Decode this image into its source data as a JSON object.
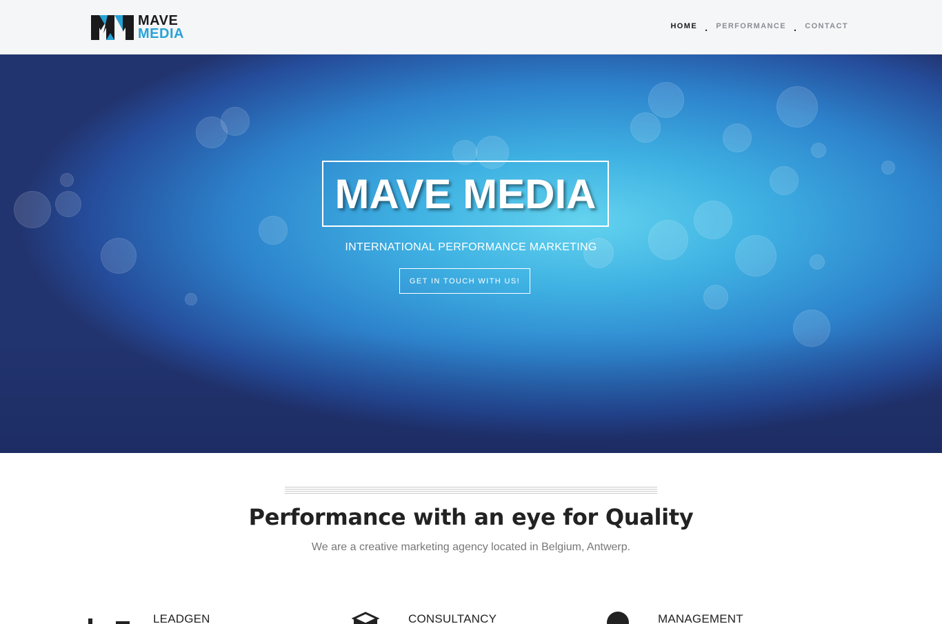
{
  "logo": {
    "line1": "MAVE",
    "line2": "MEDIA",
    "colors": {
      "dark": "#1a1a1a",
      "accent": "#27a3d6"
    }
  },
  "nav": {
    "items": [
      {
        "label": "HOME",
        "active": true
      },
      {
        "label": "PERFORMANCE",
        "active": false
      },
      {
        "label": "CONTACT",
        "active": false
      }
    ],
    "separator": "."
  },
  "hero": {
    "title": "MAVE MEDIA",
    "subtitle": "INTERNATIONAL PERFORMANCE MARKETING",
    "cta_label": "GET IN TOUCH WITH US!"
  },
  "section": {
    "title": "Performance with an eye for Quality",
    "subtitle": "We are a creative marketing agency located in Belgium, Antwerp."
  },
  "services": [
    {
      "title": "LEADGEN",
      "icon": "chart-bars-icon"
    },
    {
      "title": "CONSULTANCY",
      "icon": "cube-icon"
    },
    {
      "title": "MANAGEMENT",
      "icon": "circle-icon"
    }
  ]
}
